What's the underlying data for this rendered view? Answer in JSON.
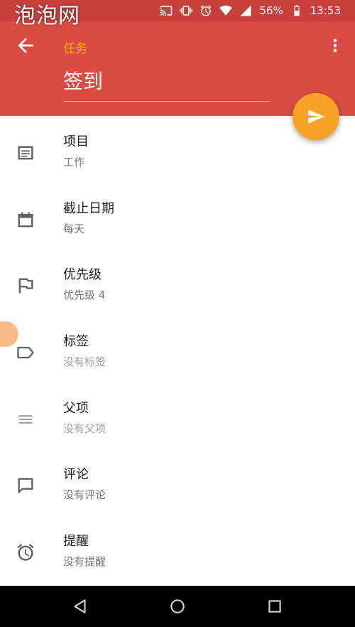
{
  "watermark": "泡泡网",
  "status_bar": {
    "battery": "56%",
    "time": "13:53"
  },
  "app_bar": {
    "section_label": "任务",
    "title": "签到"
  },
  "fields": [
    {
      "title": "项目",
      "value": "工作",
      "icon": "list-icon"
    },
    {
      "title": "截止日期",
      "value": "每天",
      "icon": "calendar-icon"
    },
    {
      "title": "优先级",
      "value": "优先级 4",
      "icon": "flag-icon"
    },
    {
      "title": "标签",
      "value": "没有标签",
      "icon": "label-icon"
    },
    {
      "title": "父项",
      "value": "没有父项",
      "icon": "menu-lines-icon"
    },
    {
      "title": "评论",
      "value": "没有评论",
      "icon": "comment-icon"
    },
    {
      "title": "提醒",
      "value": "没有提醒",
      "icon": "alarm-icon"
    }
  ],
  "colors": {
    "app_bar": "#da4c43",
    "status_bar": "#c9403a",
    "accent": "#f8a326",
    "section_label": "#ffb300"
  }
}
